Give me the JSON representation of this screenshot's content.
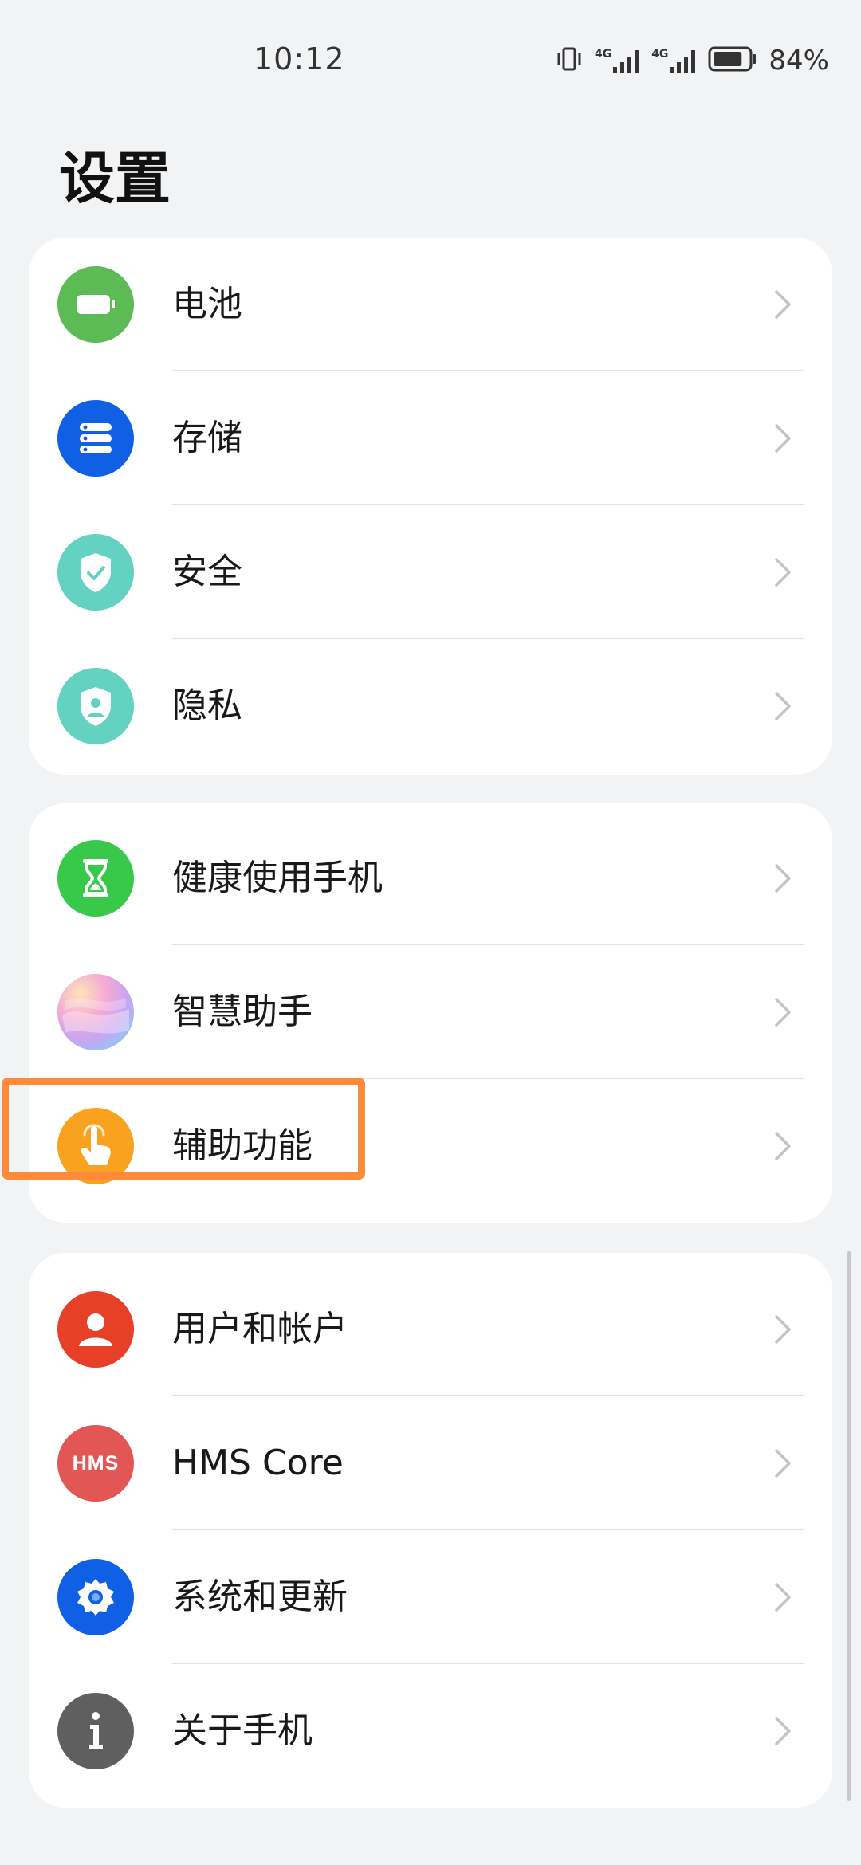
{
  "status_bar": {
    "time": "10:12",
    "signal_1_label": "4G",
    "signal_2_label": "4G",
    "battery_percent": "84%",
    "battery_level": 0.84
  },
  "page": {
    "title": "设置"
  },
  "groups": [
    {
      "items": [
        {
          "label": "电池",
          "icon": "battery-icon",
          "color": "#5dbb55"
        },
        {
          "label": "存储",
          "icon": "storage-icon",
          "color": "#1060e6"
        },
        {
          "label": "安全",
          "icon": "security-shield-icon",
          "color": "#63d2c0"
        },
        {
          "label": "隐私",
          "icon": "privacy-shield-icon",
          "color": "#63d2c0"
        }
      ]
    },
    {
      "items": [
        {
          "label": "健康使用手机",
          "icon": "hourglass-icon",
          "color": "#39c94a"
        },
        {
          "label": "智慧助手",
          "icon": "smart-assistant-icon",
          "color": "#e7a7d8"
        },
        {
          "label": "辅助功能",
          "icon": "accessibility-hand-icon",
          "color": "#f8a21f"
        }
      ]
    },
    {
      "items": [
        {
          "label": "用户和帐户",
          "icon": "user-icon",
          "color": "#e64128"
        },
        {
          "label": "HMS Core",
          "icon": "hms-icon",
          "color": "#e25656",
          "icon_text": "HMS"
        },
        {
          "label": "系统和更新",
          "icon": "gear-icon",
          "color": "#1060e6"
        },
        {
          "label": "关于手机",
          "icon": "info-icon",
          "color": "#5f5f5f"
        }
      ]
    }
  ],
  "highlight": {
    "target": "辅助功能",
    "color": "#ff8a3a"
  }
}
